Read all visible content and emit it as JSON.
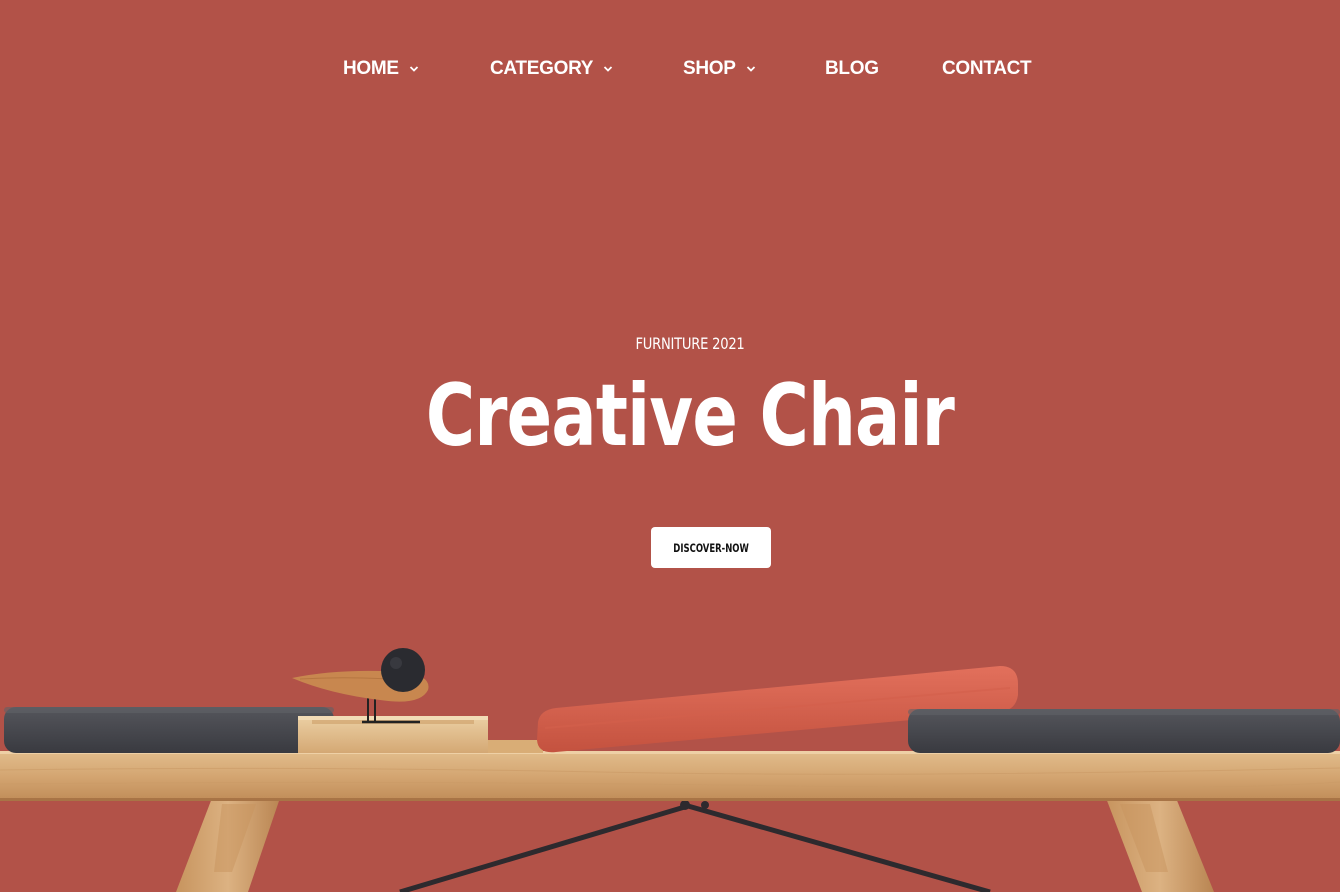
{
  "nav": {
    "items": [
      {
        "label": "HOME",
        "has_dropdown": true
      },
      {
        "label": "CATEGORY",
        "has_dropdown": true
      },
      {
        "label": "SHOP",
        "has_dropdown": true
      },
      {
        "label": "BLOG",
        "has_dropdown": false
      },
      {
        "label": "CONTACT",
        "has_dropdown": false
      }
    ],
    "dropdown_icon": "chevron-down-icon"
  },
  "hero": {
    "subtitle": "FURNITURE 2021",
    "title": "Creative Chair",
    "cta_label": "DISCOVER-NOW"
  },
  "colors": {
    "background": "#b25248",
    "text": "#ffffff",
    "button_bg": "#ffffff",
    "button_text": "#111111"
  }
}
